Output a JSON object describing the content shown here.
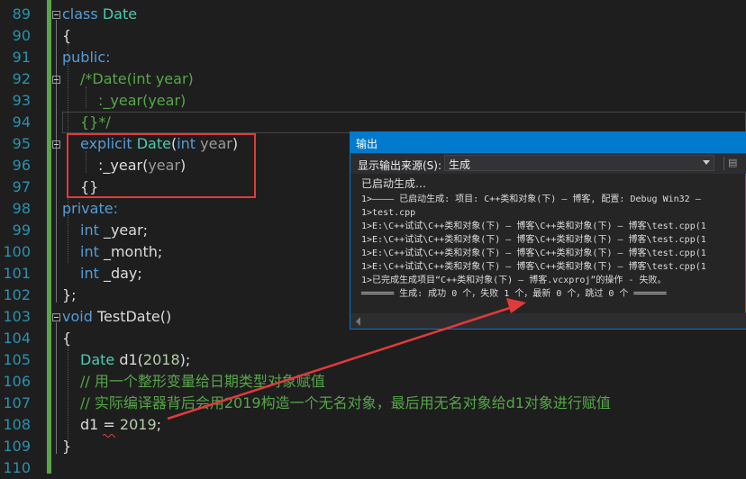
{
  "editor": {
    "line_numbers": [
      "89",
      "90",
      "91",
      "92",
      "93",
      "94",
      "95",
      "96",
      "97",
      "98",
      "99",
      "100",
      "101",
      "102",
      "103",
      "104",
      "105",
      "106",
      "107",
      "108",
      "109",
      "110"
    ],
    "lines": {
      "l89": {
        "kw": "class",
        "name": "Date"
      },
      "l90": "{",
      "l91": "public:",
      "l92": {
        "c1": "/*Date(",
        "c2": "int",
        "c3": " year)"
      },
      "l93": {
        "c1": ":_year(year)"
      },
      "l94": {
        "c1": "{}*/"
      },
      "l95": {
        "kw": "explicit",
        "name": "Date",
        "open": "(",
        "type": "int",
        "param": "year",
        "close": ")"
      },
      "l96": {
        "a": ":_year(",
        "p": "year",
        "b": ")"
      },
      "l97": "{}",
      "l98": "private:",
      "l99": {
        "kw": "int",
        "name": "_year;"
      },
      "l100": {
        "kw": "int",
        "name": "_month;"
      },
      "l101": {
        "kw": "int",
        "name": "_day;"
      },
      "l102": "};",
      "l103": {
        "kw": "void",
        "name": "TestDate()"
      },
      "l104": "{",
      "l105": {
        "type": "Date",
        "rest": "d1(",
        "num": "2018",
        "end": ");"
      },
      "l106": "// 用一个整形变量给日期类型对象赋值",
      "l107": "// 实际编译器背后会用2019构造一个无名对象，最后用无名对象给d1对象进行赋值",
      "l108": {
        "a": "d1 ",
        "op": "=",
        "b": " ",
        "num": "2019",
        "end": ";"
      },
      "l109": "}"
    }
  },
  "output_panel": {
    "title": "输出",
    "source_label": "显示输出来源(S):",
    "source_value": "生成",
    "lines": [
      "已启动生成…",
      "1>———— 已启动生成: 项目: C++类和对象(下) — 博客, 配置: Debug Win32 —",
      "1>test.cpp",
      "1>E:\\C++试试\\C++类和对象(下) — 博客\\C++类和对象(下) — 博客\\test.cpp(1",
      "1>E:\\C++试试\\C++类和对象(下) — 博客\\C++类和对象(下) — 博客\\test.cpp(1",
      "1>E:\\C++试试\\C++类和对象(下) — 博客\\C++类和对象(下) — 博客\\test.cpp(1",
      "1>E:\\C++试试\\C++类和对象(下) — 博客\\C++类和对象(下) — 博客\\test.cpp(1",
      "1>已完成生成项目“C++类和对象(下) — 博客.vcxproj”的操作 - 失败。",
      "══════ 生成: 成功 0 个，失败 1 个，最新 0 个，跳过 0 个 ══════"
    ]
  },
  "colors": {
    "accent": "#007acc",
    "annotation": "#e23a3a"
  }
}
